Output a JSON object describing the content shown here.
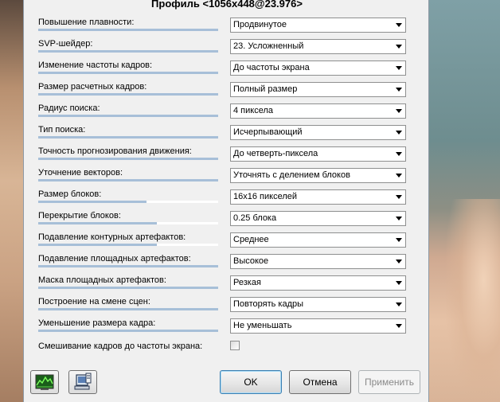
{
  "dialog": {
    "title": "Профиль <1056x448@23.976>"
  },
  "settings": [
    {
      "label": "Повышение плавности:",
      "value": "Продвинутое",
      "slider": 1.0
    },
    {
      "label": "SVP-шейдер:",
      "value": "23. Усложненный",
      "slider": 1.0
    },
    {
      "label": "Изменение частоты кадров:",
      "value": "До частоты экрана",
      "slider": 1.0
    },
    {
      "label": "Размер расчетных кадров:",
      "value": "Полный размер",
      "slider": 1.0
    },
    {
      "label": "Радиус поиска:",
      "value": "4 пиксела",
      "slider": 1.0
    },
    {
      "label": "Тип поиска:",
      "value": "Исчерпывающий",
      "slider": 1.0
    },
    {
      "label": "Точность прогнозирования движения:",
      "value": "До четверть-пиксела",
      "slider": 1.0
    },
    {
      "label": "Уточнение векторов:",
      "value": "Уточнять с делением блоков",
      "slider": 1.0
    },
    {
      "label": "Размер блоков:",
      "value": "16x16 пикселей",
      "slider": 0.6
    },
    {
      "label": "Перекрытие блоков:",
      "value": "0.25 блока",
      "slider": 0.66
    },
    {
      "label": "Подавление контурных артефактов:",
      "value": "Среднее",
      "slider": 0.66
    },
    {
      "label": "Подавление площадных артефактов:",
      "value": "Высокое",
      "slider": 1.0
    },
    {
      "label": "Маска площадных артефактов:",
      "value": "Резкая",
      "slider": 1.0
    },
    {
      "label": "Построение на смене сцен:",
      "value": "Повторять кадры",
      "slider": 1.0
    },
    {
      "label": "Уменьшение размера кадра:",
      "value": "Не уменьшать",
      "slider": 1.0
    }
  ],
  "blend": {
    "label": "Смешивание кадров до частоты экрана:",
    "checked": false
  },
  "buttons": {
    "ok": "OK",
    "cancel": "Отмена",
    "apply": "Применить"
  },
  "icons": [
    "graph-monitor-icon",
    "computer-settings-icon"
  ],
  "colors": {
    "slider_fill": "#a7bfd8",
    "default_button_border": "#3c7fb1"
  }
}
